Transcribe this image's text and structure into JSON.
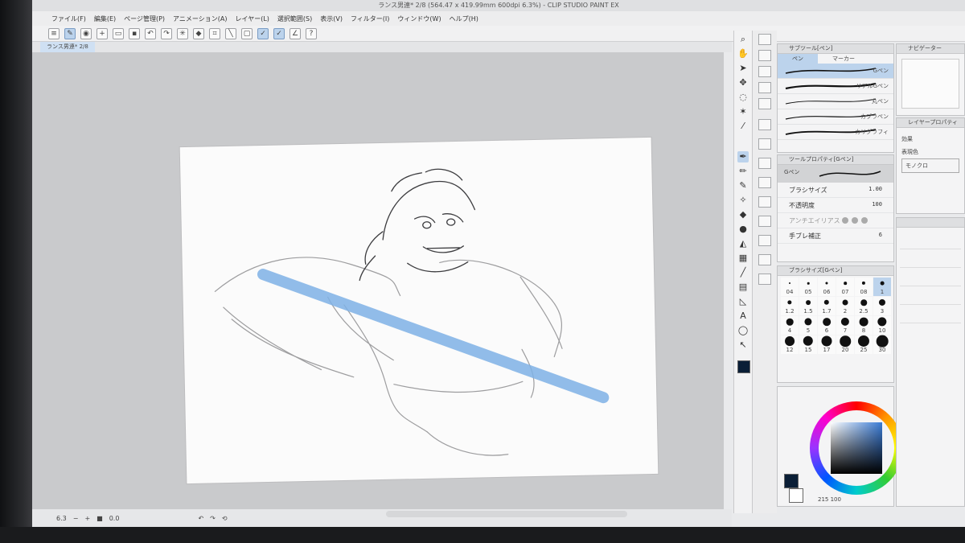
{
  "window": {
    "title": "ランス男連* 2/8 (564.47 x 419.99mm 600dpi 6.3%) - CLIP STUDIO PAINT EX"
  },
  "menu": [
    "ファイル(F)",
    "編集(E)",
    "ページ管理(P)",
    "アニメーション(A)",
    "レイヤー(L)",
    "選択範囲(S)",
    "表示(V)",
    "フィルター(I)",
    "ウィンドウ(W)",
    "ヘルプ(H)"
  ],
  "tab": {
    "label": "ランス男連* 2/8"
  },
  "status": {
    "zoom": "6.3",
    "field": "0.0"
  },
  "subtool_panel": {
    "title": "サブツール[ペン]",
    "tabs": [
      "ペン",
      "マーカー"
    ],
    "pens": [
      "Gペン",
      "リアルGペン",
      "丸ペン",
      "カブラペン",
      "カリグラフィ"
    ]
  },
  "tool_property": {
    "title": "ツールプロパティ[Gペン]",
    "tool_name": "Gペン",
    "rows": [
      {
        "label": "ブラシサイズ",
        "value": "1.00"
      },
      {
        "label": "不透明度",
        "value": "100"
      },
      {
        "label": "アンチエイリアス",
        "value": ""
      },
      {
        "label": "手ブレ補正",
        "value": "6"
      }
    ]
  },
  "brush_size_panel": {
    "title": "ブラシサイズ[Gペン]",
    "sizes": [
      "04",
      "05",
      "06",
      "07",
      "08",
      "1",
      "1.2",
      "1.5",
      "1.7",
      "2",
      "2.5",
      "3",
      "4",
      "5",
      "6",
      "7",
      "8",
      "10",
      "12",
      "15",
      "17",
      "20",
      "25",
      "30"
    ],
    "selected": "1"
  },
  "navigator": {
    "title": "ナビゲーター"
  },
  "layer_property": {
    "title": "レイヤープロパティ",
    "items": [
      "効果",
      "表現色",
      "モノクロ"
    ]
  },
  "color": {
    "main": "#0a1e36",
    "sub": "#ffffff",
    "accent": "#3a7bd5",
    "readout": "215 100"
  }
}
